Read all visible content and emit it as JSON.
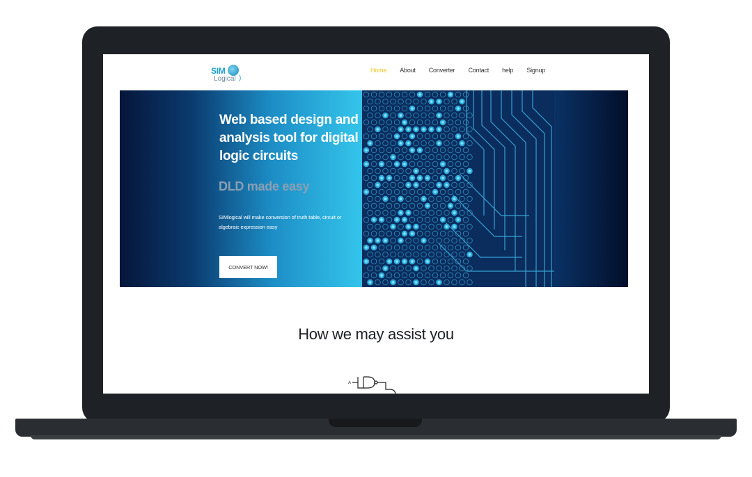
{
  "logo": {
    "sim": "SIM",
    "logical": "Logical"
  },
  "nav": {
    "items": [
      {
        "label": "Home",
        "active": true
      },
      {
        "label": "About",
        "active": false
      },
      {
        "label": "Converter",
        "active": false
      },
      {
        "label": "Contact",
        "active": false
      },
      {
        "label": "help",
        "active": false
      },
      {
        "label": "Signup",
        "active": false
      }
    ]
  },
  "hero": {
    "title": "Web based design and analysis tool for digital logic circuits",
    "tagline": "DLD made easy",
    "description": "SIMlogical will make conversion of truth table, circuit or algebraic expression easy",
    "button_label": "CONVERT NOW!"
  },
  "section": {
    "title": "How we may assist you"
  },
  "colors": {
    "accent": "#f1c21a",
    "brand": "#1d9fd0",
    "hero_dark": "#06163a",
    "hero_light": "#33c3ea"
  },
  "icons": [
    "logic-gate-icon"
  ]
}
